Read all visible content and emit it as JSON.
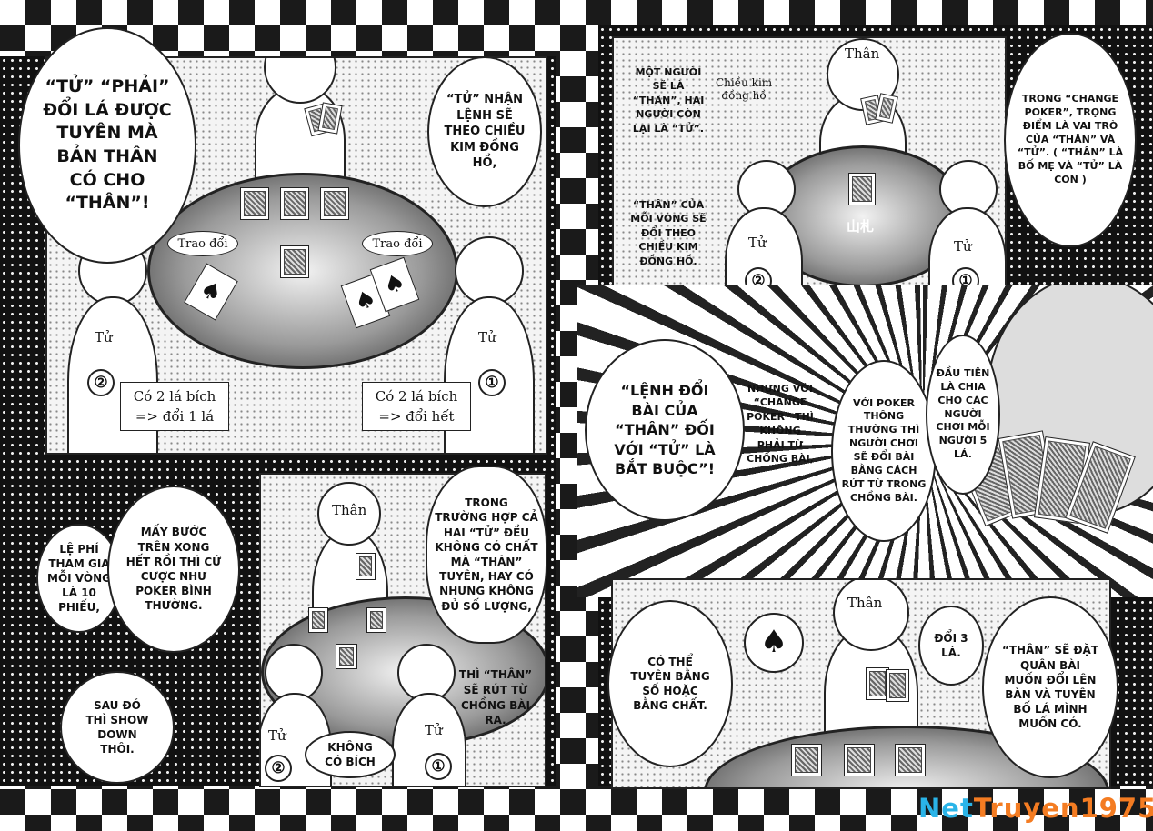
{
  "watermark": {
    "part1": "Net",
    "part2": "Truyen1975"
  },
  "labels": {
    "than": "Thân",
    "tu": "Tử",
    "one": "①",
    "two": "②",
    "trao_doi": "Trao đổi",
    "chieu_kim": "Chiều kim\nđồng hồ",
    "yamafuda": "山札"
  },
  "panel1": {
    "bubble_left": "“Tử” “phải”\nđổi lá được\ntuyên mà\nbản thân\ncó cho\n“Thân”!",
    "bubble_right": "“Tử” nhận\nlệnh sẽ\ntheo chiều\nkim đồng\nhồ,",
    "box_left": "Có 2 lá bích\n=> đổi 1 lá",
    "box_right": "Có 2 lá bích\n=> đổi hết"
  },
  "panel2": {
    "bubble_right": "Trong\ntrường hợp cả\nhai “tử” đều\nkhông có chất\nmà “thân”\ntuyên, hay có\nnhưng không\nđủ số lượng,",
    "text_right": "Thì “thân”\nsẽ rút từ\nchồng bài\nra.",
    "bubble_small": "Không\ncó bích"
  },
  "left_bottom": {
    "bubble_a": "Lệ phí\ntham gia\nmỗi vòng\nlà 10\nphiếu,",
    "bubble_b": "Mấy bước\ntrên xong\nhết rồi thì cứ\ncược như\npoker bình\nthường.",
    "bubble_c": "Sau đó\nthì show\ndown\nthôi."
  },
  "panel3": {
    "text_a": "Một người\nsẽ là\n“Thân”, hai\nngười còn\nlại là “tử”.",
    "text_b": "“Thân” của\nmỗi vòng sẽ\nđổi theo\nchiều kim\nđồng hồ.",
    "bubble_right": "Trong “change\npoker”, trọng\nđiểm là vai trò\ncủa “thân” và\n“tử”. ( “thân” là\nbố mẹ và “tử” là\ncon )"
  },
  "panel4": {
    "big_text": "“Lệnh đổi\nbài của\n“thân” đối\nvới “tử” là\nbắt buộc”!",
    "text_a": "Nhưng với\n“change\npoker” thì\nkhông\nphải từ\nchồng bài,",
    "bubble_b": "Với poker\nthông\nthường thì\nngười chơi\nsẽ đổi bài\nbằng cách\nrút từ trong\nchồng bài.",
    "bubble_c": "Đầu tiên\nlà chia\ncho các\nngười\nchơi mỗi\nngười 5\nlá."
  },
  "panel5": {
    "bubble_left": "Có thể\ntuyên bằng\nsố hoặc\nbằng chất.",
    "bubble_mid": "Đổi 3\nlá.",
    "bubble_right": "“Thân” sẽ đặt\nquân bài\nmuốn đổi lên\nbàn và tuyên\nbố lá mình\nmuốn có."
  }
}
